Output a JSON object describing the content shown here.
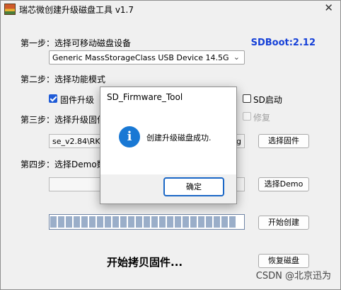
{
  "window": {
    "title": "瑞芯微创建升级磁盘工具 v1.7",
    "close": "✕"
  },
  "step1": {
    "label": "第一步：选择可移动磁盘设备",
    "device": "Generic MassStorageClass USB Device   14.5G",
    "sdboot": "SDBoot:2.12"
  },
  "step2": {
    "label": "第二步：选择功能模式",
    "firmware_upgrade": {
      "label": "固件升级",
      "checked": true
    },
    "sd_boot": {
      "label": "SD启动",
      "checked": false
    },
    "repair": {
      "label": "修复",
      "checked": false,
      "disabled": true
    }
  },
  "step3": {
    "label": "第三步：选择升级固件",
    "path_left": "se_v2.84\\RKD",
    "path_right": "g",
    "button": "选择固件"
  },
  "step4": {
    "label": "第四步：选择Demo数据",
    "button": "选择Demo"
  },
  "create_button": "开始创建",
  "restore_button": "恢复磁盘",
  "status_text": "开始拷贝固件...",
  "progress": {
    "segments": 24
  },
  "watermark": "CSDN @北京迅为",
  "dialog": {
    "title": "SD_Firmware_Tool",
    "icon": "info-icon",
    "icon_glyph": "i",
    "message": "创建升级磁盘成功.",
    "ok": "确定"
  }
}
